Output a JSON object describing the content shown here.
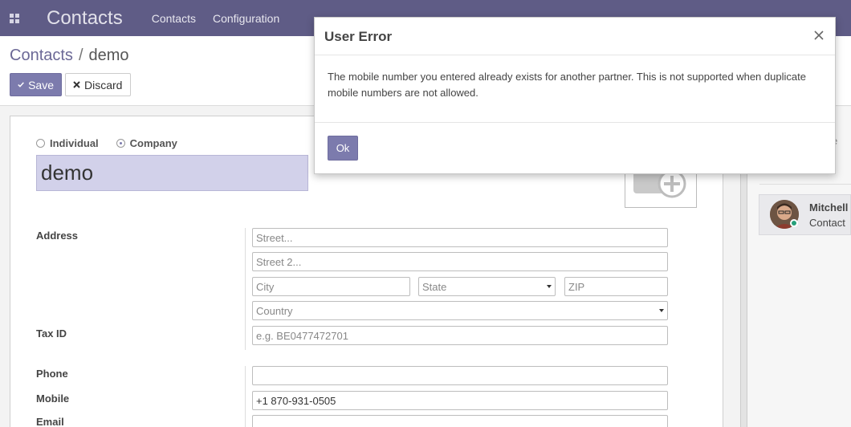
{
  "navbar": {
    "app_icon": "apps-grid-icon",
    "brand": "Contacts",
    "menu": [
      "Contacts",
      "Configuration"
    ]
  },
  "breadcrumb": {
    "parent": "Contacts",
    "separator": "/",
    "current": "demo"
  },
  "toolbar": {
    "save_label": "Save",
    "save_icon": "check-icon",
    "discard_label": "Discard",
    "discard_icon": "close-icon"
  },
  "form": {
    "company_type_options": [
      "Individual",
      "Company"
    ],
    "company_type_selected": "Company",
    "name": "demo",
    "address_label": "Address",
    "street_placeholder": "Street...",
    "street2_placeholder": "Street 2...",
    "city_placeholder": "City",
    "state_placeholder": "State",
    "zip_placeholder": "ZIP",
    "country_placeholder": "Country",
    "tax_label": "Tax ID",
    "tax_placeholder": "e.g. BE0477472701",
    "phone_label": "Phone",
    "phone_value": "",
    "mobile_label": "Mobile",
    "mobile_value": "+1 870-931-0505",
    "email_label": "Email"
  },
  "chatter": {
    "header_fragment": "e",
    "follower_name": "Mitchell",
    "follower_role": "Contact"
  },
  "dialog": {
    "title": "User Error",
    "message": "The mobile number you entered already exists for another partner. This is not supported when duplicate mobile numbers are not allowed.",
    "ok_label": "Ok"
  },
  "colors": {
    "navbar": "#5f5c86",
    "primary": "#7c7bad",
    "name_field_bg": "#d2d1ea"
  }
}
